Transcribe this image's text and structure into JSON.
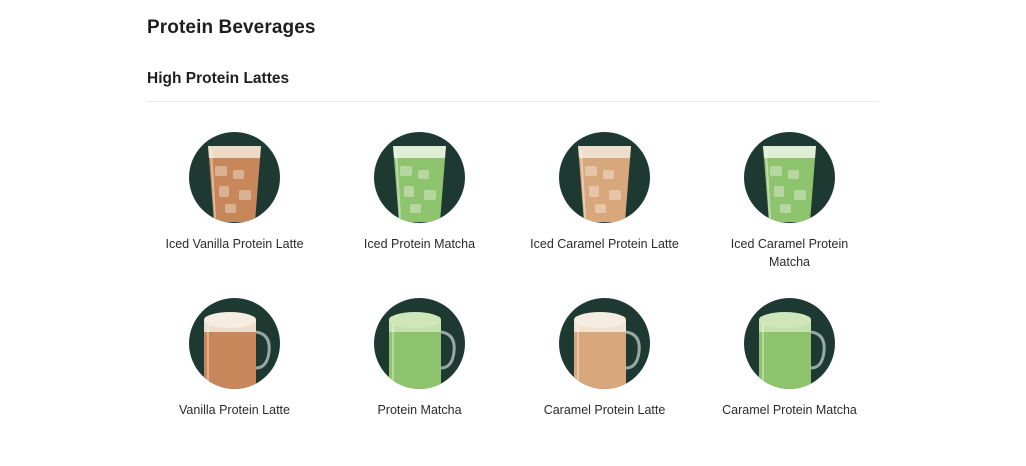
{
  "page": {
    "title": "Protein Beverages"
  },
  "section": {
    "title": "High Protein Lattes"
  },
  "colors": {
    "thumb_background": "#1e3932",
    "latte": "#c8875a",
    "matcha": "#8fc46e",
    "caramel": "#d9a77c"
  },
  "products": [
    {
      "name": "Iced Vanilla Protein Latte",
      "style": "iced",
      "drink": "latte"
    },
    {
      "name": "Iced Protein Matcha",
      "style": "iced",
      "drink": "matcha"
    },
    {
      "name": "Iced Caramel Protein Latte",
      "style": "iced",
      "drink": "caramel"
    },
    {
      "name": "Iced Caramel Protein Matcha",
      "style": "iced",
      "drink": "matcha"
    },
    {
      "name": "Vanilla Protein Latte",
      "style": "hot",
      "drink": "latte"
    },
    {
      "name": "Protein Matcha",
      "style": "hot",
      "drink": "matcha"
    },
    {
      "name": "Caramel Protein Latte",
      "style": "hot",
      "drink": "caramel"
    },
    {
      "name": "Caramel Protein Matcha",
      "style": "hot",
      "drink": "matcha"
    }
  ]
}
